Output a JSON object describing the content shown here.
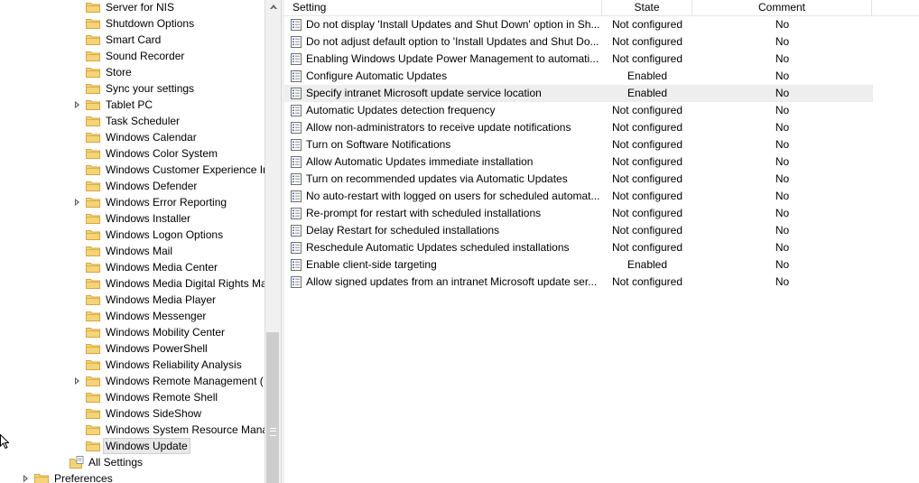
{
  "tree": {
    "items": [
      {
        "label": "Server for NIS",
        "expandable": false
      },
      {
        "label": "Shutdown Options",
        "expandable": false
      },
      {
        "label": "Smart Card",
        "expandable": false
      },
      {
        "label": "Sound Recorder",
        "expandable": false
      },
      {
        "label": "Store",
        "expandable": false
      },
      {
        "label": "Sync your settings",
        "expandable": false
      },
      {
        "label": "Tablet PC",
        "expandable": true
      },
      {
        "label": "Task Scheduler",
        "expandable": false
      },
      {
        "label": "Windows Calendar",
        "expandable": false
      },
      {
        "label": "Windows Color System",
        "expandable": false
      },
      {
        "label": "Windows Customer Experience In",
        "expandable": false
      },
      {
        "label": "Windows Defender",
        "expandable": false
      },
      {
        "label": "Windows Error Reporting",
        "expandable": true
      },
      {
        "label": "Windows Installer",
        "expandable": false
      },
      {
        "label": "Windows Logon Options",
        "expandable": false
      },
      {
        "label": "Windows Mail",
        "expandable": false
      },
      {
        "label": "Windows Media Center",
        "expandable": false
      },
      {
        "label": "Windows Media Digital Rights Ma",
        "expandable": false
      },
      {
        "label": "Windows Media Player",
        "expandable": false
      },
      {
        "label": "Windows Messenger",
        "expandable": false
      },
      {
        "label": "Windows Mobility Center",
        "expandable": false
      },
      {
        "label": "Windows PowerShell",
        "expandable": false
      },
      {
        "label": "Windows Reliability Analysis",
        "expandable": false
      },
      {
        "label": "Windows Remote Management (",
        "expandable": true
      },
      {
        "label": "Windows Remote Shell",
        "expandable": false
      },
      {
        "label": "Windows SideShow",
        "expandable": false
      },
      {
        "label": "Windows System Resource Mana",
        "expandable": false
      },
      {
        "label": "Windows Update",
        "expandable": false,
        "selected": true
      }
    ],
    "all_settings": "All Settings",
    "preferences": "Preferences"
  },
  "list": {
    "columns": {
      "setting": "Setting",
      "state": "State",
      "comment": "Comment"
    },
    "rows": [
      {
        "setting": "Do not display 'Install Updates and Shut Down' option in Sh...",
        "state": "Not configured",
        "comment": "No"
      },
      {
        "setting": "Do not adjust default option to 'Install Updates and Shut Do...",
        "state": "Not configured",
        "comment": "No"
      },
      {
        "setting": "Enabling Windows Update Power Management to automati...",
        "state": "Not configured",
        "comment": "No"
      },
      {
        "setting": "Configure Automatic Updates",
        "state": "Enabled",
        "comment": "No"
      },
      {
        "setting": "Specify intranet Microsoft update service location",
        "state": "Enabled",
        "comment": "No",
        "highlight": true
      },
      {
        "setting": "Automatic Updates detection frequency",
        "state": "Not configured",
        "comment": "No"
      },
      {
        "setting": "Allow non-administrators to receive update notifications",
        "state": "Not configured",
        "comment": "No"
      },
      {
        "setting": "Turn on Software Notifications",
        "state": "Not configured",
        "comment": "No"
      },
      {
        "setting": "Allow Automatic Updates immediate installation",
        "state": "Not configured",
        "comment": "No"
      },
      {
        "setting": "Turn on recommended updates via Automatic Updates",
        "state": "Not configured",
        "comment": "No"
      },
      {
        "setting": "No auto-restart with logged on users for scheduled automat...",
        "state": "Not configured",
        "comment": "No"
      },
      {
        "setting": "Re-prompt for restart with scheduled installations",
        "state": "Not configured",
        "comment": "No"
      },
      {
        "setting": "Delay Restart for scheduled installations",
        "state": "Not configured",
        "comment": "No"
      },
      {
        "setting": "Reschedule Automatic Updates scheduled installations",
        "state": "Not configured",
        "comment": "No"
      },
      {
        "setting": "Enable client-side targeting",
        "state": "Enabled",
        "comment": "No"
      },
      {
        "setting": "Allow signed updates from an intranet Microsoft update ser...",
        "state": "Not configured",
        "comment": "No"
      }
    ]
  },
  "colors": {
    "folder_fill": "#f4d479",
    "folder_edge": "#d6a73a",
    "highlight_row": "#eeeeee"
  }
}
